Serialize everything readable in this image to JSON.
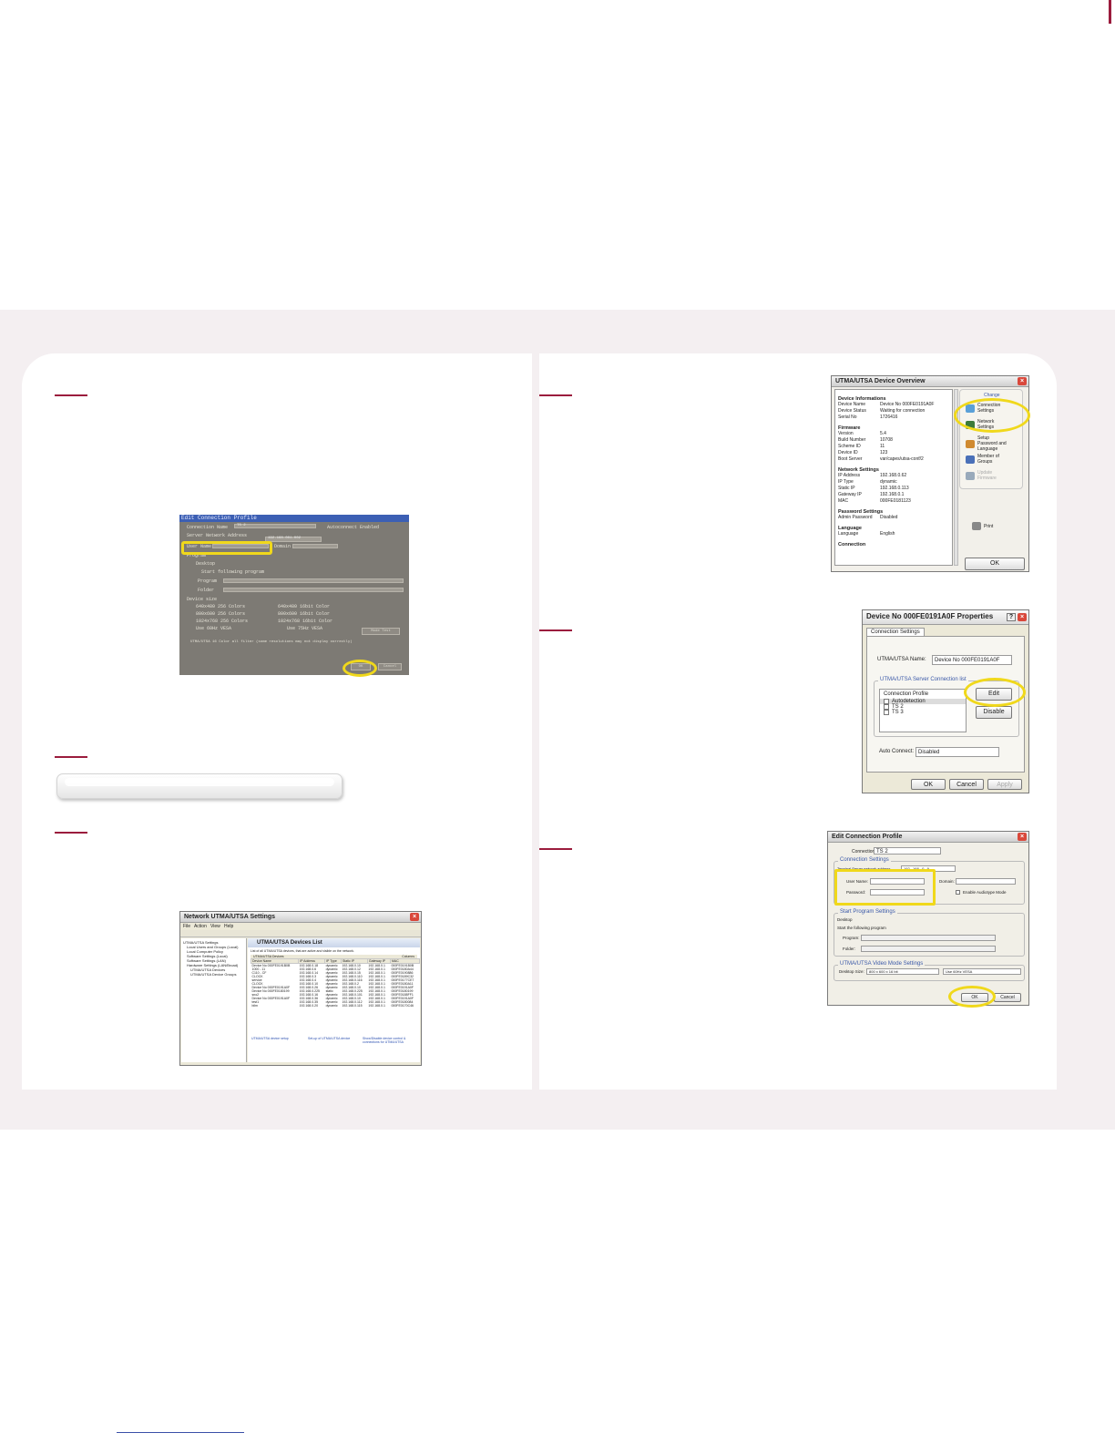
{
  "photo_window": {
    "title": "Edit Connection Profile",
    "connection_name_label": "Connection Name",
    "connection_name_value": "TS 2",
    "autoconnect_label": "Autoconnect Enabled",
    "server_address_label": "Server Network Address",
    "server_address_value": "192.168.001.002",
    "user_name_label": "User Name",
    "domain_label": "Domain",
    "program_group_label": "Program",
    "desktop_option": "Desktop",
    "start_program_option": "Start following program",
    "program_label": "Program",
    "folder_label": "Folder",
    "device_size_label": "Device size",
    "res_640": "640x480 256 Colors",
    "res_800": "800x600 256 Colors",
    "res_1024": "1024x768 256 Colors",
    "use_vesa": "Use 60Hz VESA",
    "col_640": "640x480 16bit Color",
    "col_800": "800x600 16bit Color",
    "col_1024": "1024x768 16bit Color",
    "use_75": "Use 75Hz VESA",
    "mode_test": "Mode Test",
    "note": "UTMA/UTSA 16 Color all filter (some resolutions may not display correctly)",
    "ok": "OK",
    "cancel": "Cancel"
  },
  "net_window": {
    "title": "Network UTMA/UTSA Settings",
    "menu": [
      "File",
      "Action",
      "View",
      "Help"
    ],
    "tree": [
      "UTMA/UTSA Settings",
      "Local Users and Groups (Local)",
      "Local Computer Policy",
      "Software Settings (Local)",
      "Software Settings (LAN)",
      "Hardware Settings (LAN/Broad)",
      "UTMA/UTSA Devices",
      "UTMA/UTSA Device Groups"
    ],
    "list_title": "UTMA/UTSA Devices List",
    "list_desc": "List of all UTMA/UTSA devices, that are active and visible on the network.",
    "devices_label": "UTMA/UTSA Devices",
    "columns_label": "Columns",
    "headers": [
      "Device Name",
      "IP Address",
      "IP Type",
      "Static IP",
      "Gateway IP",
      "MAC"
    ],
    "rows": [
      [
        "Device No 000FE0191B0B",
        "192.168.0.18",
        "dynamic",
        "192.168.0.10",
        "192.168.0.1",
        "000FE0191B0B"
      ],
      [
        "1000 - 11",
        "192.168.0.6",
        "dynamic",
        "192.168.0.12",
        "192.168.0.1",
        "000FE0180A44"
      ],
      [
        "C110 - CF",
        "192.168.0.14",
        "dynamic",
        "192.168.0.15",
        "192.168.0.1",
        "000FE0190886"
      ],
      [
        "CLOCK",
        "192.168.0.3",
        "dynamic",
        "192.168.0.110",
        "192.168.0.1",
        "000FE0189C32"
      ],
      [
        "service",
        "192.168.0.4",
        "dynamic",
        "192.168.0.116",
        "192.168.0.1",
        "000FE0177CE7"
      ],
      [
        "CLOCK",
        "192.168.0.10",
        "dynamic",
        "192.168.0.2",
        "192.168.0.1",
        "000FE0180A11"
      ],
      [
        "Device No 000FE0191A0F",
        "192.168.0.26",
        "dynamic",
        "192.168.0.10",
        "192.168.0.1",
        "000FE0191A0F"
      ],
      [
        "Device No 000FE0180199",
        "192.168.0.225",
        "static",
        "192.168.0.225",
        "192.168.0.1",
        "000FE0180199"
      ],
      [
        "sno2",
        "192.168.0.16",
        "dynamic",
        "192.168.0.101",
        "192.168.0.1",
        "000FE0188FF1"
      ],
      [
        "Device No 000FE0191A0F",
        "192.168.0.36",
        "dynamic",
        "192.168.0.10",
        "192.168.0.1",
        "000FE0191A0F"
      ],
      [
        "test1",
        "192.168.0.35",
        "dynamic",
        "192.168.0.112",
        "192.168.0.1",
        "000FE0180084"
      ],
      [
        "bilm",
        "192.168.0.20",
        "dynamic",
        "192.168.0.115",
        "192.168.0.1",
        "000FE0170C46"
      ]
    ],
    "link1": "UTMA/UTSA device setup",
    "link2": "Set-up of UTMA/UTSA device",
    "link3": "Show/Disable device control & connections for UTMA/UTSA"
  },
  "overview_window": {
    "title": "UTMA/UTSA Device Overview",
    "sections": [
      {
        "header": "Device Informations",
        "rows": [
          [
            "Device Name",
            "Device No 000FE0191A0F"
          ],
          [
            "Device Status",
            "Waiting for connection"
          ],
          [
            "Serial No",
            "1726416"
          ]
        ]
      },
      {
        "header": "Firmware",
        "rows": [
          [
            "Version",
            "5.4"
          ],
          [
            "Build Number",
            "10708"
          ],
          [
            "Scheme ID",
            "11"
          ],
          [
            "Device ID",
            "123"
          ],
          [
            "Boot Server",
            "var/capes/utsa-conf/2"
          ]
        ]
      },
      {
        "header": "Network Settings",
        "rows": [
          [
            "IP Address",
            "192.168.0.62"
          ],
          [
            "IP Type",
            "dynamic"
          ],
          [
            "Static IP",
            "192.168.0.113"
          ],
          [
            "Gateway IP",
            "192.168.0.1"
          ],
          [
            "MAC",
            "000FE0181123"
          ]
        ]
      },
      {
        "header": "Password Settings",
        "rows": [
          [
            "Admin Password",
            "Disabled"
          ]
        ]
      },
      {
        "header": "Language",
        "rows": [
          [
            "Language",
            "English"
          ]
        ]
      },
      {
        "header": "Connection",
        "rows": []
      }
    ],
    "change_label": "Change",
    "items": [
      "Connection Settings",
      "Network Settings",
      "Setup Password and Language",
      "Member of Groups",
      "Update Firmware"
    ],
    "print": "Print",
    "ok": "OK"
  },
  "props_window": {
    "title": "Device No 000FE0191A0F Properties",
    "tab": "Connection Settings",
    "name_label": "UTMA/UTSA Name:",
    "name_value": "Device No 000FE0191A0F",
    "group_label": "UTMA/UTSA Server Connection list",
    "list_header": "Connection Profile",
    "items": [
      "Autodetection",
      "TS 2",
      "TS 3"
    ],
    "edit": "Edit",
    "disable": "Disable",
    "auto_label": "Auto Connect:",
    "auto_value": "Disabled",
    "ok": "OK",
    "cancel": "Cancel",
    "apply": "Apply"
  },
  "edit_window": {
    "title": "Edit Connection Profile",
    "connection_label": "Connection",
    "connection_value": "TS 2",
    "settings_group": "Connection Settings",
    "server_label": "Terminal Server network address",
    "ip": [
      "192",
      "168",
      "0",
      "9"
    ],
    "user_label": "User Name:",
    "password_label": "Password:",
    "domain_label": "Domain:",
    "audio_label": "Enable Audiotype Mode",
    "program_group": "Start Program Settings",
    "desktop": "Desktop",
    "start_program": "Start the following program",
    "program_label": "Program:",
    "folder_label": "Folder:",
    "video_group": "UTMA/UTSA Video Mode Settings",
    "desktop_size_label": "Desktop Size:",
    "desktop_size_value": "800 x 600 x 16 bit",
    "refresh_value": "Use 60Hz VESA",
    "ok": "OK",
    "cancel": "Cancel"
  },
  "colors": {
    "accent": "#9b1c3d",
    "highlight": "#f0d81b",
    "band": "#f4eff1"
  }
}
